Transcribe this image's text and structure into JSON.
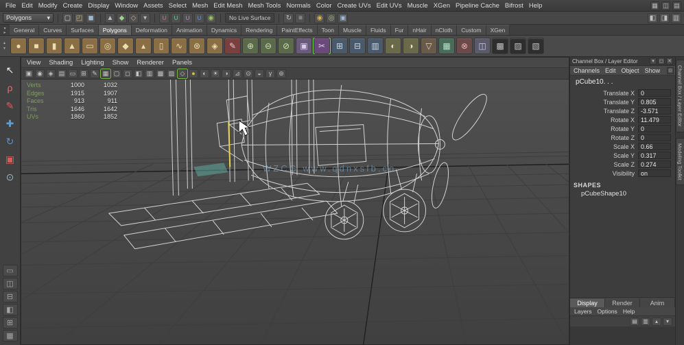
{
  "viewport": {
    "watermark": "WZCG  www.qdnxsfb.co"
  },
  "menubar": {
    "items": [
      "File",
      "Edit",
      "Modify",
      "Create",
      "Display",
      "Window",
      "Assets",
      "Select",
      "Mesh",
      "Edit Mesh",
      "Mesh Tools",
      "Normals",
      "Color",
      "Create UVs",
      "Edit UVs",
      "Muscle",
      "XGen",
      "Pipeline Cache",
      "Bifrost",
      "Help"
    ],
    "corner_icons": [
      {
        "name": "workspace-icon",
        "glyph": "▦"
      },
      {
        "name": "panel-layout-icon",
        "glyph": "◫"
      },
      {
        "name": "outliner-toggle-icon",
        "glyph": "▤"
      }
    ]
  },
  "statusline": {
    "menuset_value": "Polygons",
    "menuset_arrow": "▾",
    "scene_icons": [
      {
        "name": "new-scene-icon",
        "glyph": "▢",
        "color": "#d0d0d0"
      },
      {
        "name": "open-scene-icon",
        "glyph": "◰",
        "color": "#d8c27a"
      },
      {
        "name": "save-scene-icon",
        "glyph": "◼",
        "color": "#9fb7d0"
      }
    ],
    "selection_icons": [
      {
        "name": "select-hierarchy-icon",
        "glyph": "▲",
        "color": "#bcbcbc"
      },
      {
        "name": "select-object-icon",
        "glyph": "◆",
        "color": "#9fd08f"
      },
      {
        "name": "select-component-icon",
        "glyph": "◇",
        "color": "#d0a98f"
      },
      {
        "name": "selection-mask-icon",
        "glyph": "▾",
        "color": "#bbbbbb"
      }
    ],
    "snap_icons": [
      {
        "name": "snap-to-grid-icon",
        "glyph": "∪",
        "color": "#d07070"
      },
      {
        "name": "snap-to-curve-icon",
        "glyph": "∪",
        "color": "#70c090"
      },
      {
        "name": "snap-to-point-icon",
        "glyph": "∪",
        "color": "#c080c0"
      },
      {
        "name": "snap-to-plane-icon",
        "glyph": "∪",
        "color": "#7090c8"
      },
      {
        "name": "make-live-icon",
        "glyph": "◉",
        "color": "#9ac060"
      }
    ],
    "live_surface_label": "No Live Surface",
    "history_icons": [
      {
        "name": "construction-history-icon",
        "glyph": "↻",
        "color": "#bfbfbf"
      },
      {
        "name": "list-inputs-icon",
        "glyph": "≡",
        "color": "#bfbfbf"
      }
    ],
    "render_icons": [
      {
        "name": "render-current-frame-icon",
        "glyph": "◉",
        "color": "#d8b24a"
      },
      {
        "name": "ipr-render-icon",
        "glyph": "◎",
        "color": "#a8c27a"
      },
      {
        "name": "render-settings-icon",
        "glyph": "▣",
        "color": "#9fb7d0"
      }
    ],
    "editor_toggles": [
      {
        "name": "sidebar-toggle-icon",
        "glyph": "◧",
        "color": "#c0c0c0"
      },
      {
        "name": "attribute-editor-toggle-icon",
        "glyph": "◨",
        "color": "#c0c0c0"
      },
      {
        "name": "channel-box-toggle-icon",
        "glyph": "▥",
        "color": "#c0c0c0"
      }
    ]
  },
  "shelf": {
    "tabs": [
      {
        "label": "General"
      },
      {
        "label": "Curves"
      },
      {
        "label": "Surfaces"
      },
      {
        "label": "Polygons",
        "active": true
      },
      {
        "label": "Deformation"
      },
      {
        "label": "Animation"
      },
      {
        "label": "Dynamics"
      },
      {
        "label": "Rendering"
      },
      {
        "label": "PaintEffects"
      },
      {
        "label": "Toon"
      },
      {
        "label": "Muscle"
      },
      {
        "label": "Fluids"
      },
      {
        "label": "Fur"
      },
      {
        "label": "nHair"
      },
      {
        "label": "nCloth"
      },
      {
        "label": "Custom"
      },
      {
        "label": "XGen"
      }
    ],
    "icons": [
      {
        "name": "poly-sphere-icon",
        "glyph": "●",
        "bg": "#8a6f46",
        "color": "#ecdcb4"
      },
      {
        "name": "poly-cube-icon",
        "glyph": "■",
        "bg": "#8a6f46",
        "color": "#ecdcb4"
      },
      {
        "name": "poly-cylinder-icon",
        "glyph": "▮",
        "bg": "#8a6f46",
        "color": "#ecdcb4"
      },
      {
        "name": "poly-cone-icon",
        "glyph": "▲",
        "bg": "#8a6f46",
        "color": "#ecdcb4"
      },
      {
        "name": "poly-plane-icon",
        "glyph": "▭",
        "bg": "#8a6f46",
        "color": "#ecdcb4"
      },
      {
        "name": "poly-torus-icon",
        "glyph": "◎",
        "bg": "#8a6f46",
        "color": "#ecdcb4"
      },
      {
        "name": "poly-prism-icon",
        "glyph": "◆",
        "bg": "#8a6f46",
        "color": "#ecdcb4"
      },
      {
        "name": "poly-pyramid-icon",
        "glyph": "▴",
        "bg": "#8a6f46",
        "color": "#ecdcb4"
      },
      {
        "name": "poly-pipe-icon",
        "glyph": "▯",
        "bg": "#8a6f46",
        "color": "#ecdcb4"
      },
      {
        "name": "poly-helix-icon",
        "glyph": "∿",
        "bg": "#8a6f46",
        "color": "#ecdcb4"
      },
      {
        "name": "poly-soccer-ball-icon",
        "glyph": "⊛",
        "bg": "#8a6f46",
        "color": "#ecdcb4"
      },
      {
        "name": "poly-platonic-icon",
        "glyph": "◈",
        "bg": "#8a6f46",
        "color": "#ecdcb4"
      },
      {
        "name": "sculpt-brush-icon",
        "glyph": "✎",
        "bg": "#7a4040",
        "color": "#f0c4c4"
      },
      {
        "name": "combine-icon",
        "glyph": "⊕",
        "bg": "#5a6a4a",
        "color": "#d2e2b2"
      },
      {
        "name": "separate-icon",
        "glyph": "⊖",
        "bg": "#5a6a4a",
        "color": "#d2e2b2"
      },
      {
        "name": "extract-icon",
        "glyph": "⊘",
        "bg": "#5a6a4a",
        "color": "#d2e2b2"
      },
      {
        "name": "smooth-mesh-icon",
        "glyph": "▣",
        "bg": "#6a5a7a",
        "color": "#dccaf2"
      },
      {
        "name": "multi-cut-icon",
        "glyph": "✂",
        "bg": "#6a4a7a",
        "color": "#e4ccf2",
        "selected": true
      },
      {
        "name": "extrude-icon",
        "glyph": "⊞",
        "bg": "#4a5a6a",
        "color": "#c4d8ec"
      },
      {
        "name": "bevel-icon",
        "glyph": "⊟",
        "bg": "#4a5a6a",
        "color": "#c4d8ec"
      },
      {
        "name": "bridge-icon",
        "glyph": "▥",
        "bg": "#4a5a6a",
        "color": "#c4d8ec"
      },
      {
        "name": "boolean-union-icon",
        "glyph": "◐",
        "bg": "#6a6a4a",
        "color": "#e4e4b4"
      },
      {
        "name": "boolean-difference-icon",
        "glyph": "◑",
        "bg": "#6a6a4a",
        "color": "#e4e4b4"
      },
      {
        "name": "reduce-icon",
        "glyph": "▽",
        "bg": "#6a5a4a",
        "color": "#e4d4c4"
      },
      {
        "name": "quad-draw-icon",
        "glyph": "▦",
        "bg": "#4a6a5a",
        "color": "#b4e4cc"
      },
      {
        "name": "target-weld-icon",
        "glyph": "⊗",
        "bg": "#6a4a4a",
        "color": "#ecb4b4"
      },
      {
        "name": "mirror-icon",
        "glyph": "◫",
        "bg": "#5a5a6a",
        "color": "#ccccec"
      },
      {
        "name": "checker-map-icon",
        "glyph": "▩",
        "bg": "#2e2e2e",
        "color": "#c0c0c0"
      },
      {
        "name": "checker-map-2-icon",
        "glyph": "▨",
        "bg": "#2e2e2e",
        "color": "#c0c0c0"
      },
      {
        "name": "uv-checker-icon",
        "glyph": "▧",
        "bg": "#2e2e2e",
        "color": "#c0c0c0"
      }
    ]
  },
  "toolbox": {
    "tools": [
      {
        "name": "select-tool-icon",
        "glyph": "↖",
        "color": "#ececec"
      },
      {
        "name": "lasso-select-tool-icon",
        "glyph": "ρ",
        "color": "#e07070"
      },
      {
        "name": "paint-select-tool-icon",
        "glyph": "✎",
        "color": "#d86060"
      },
      {
        "name": "move-tool-icon",
        "glyph": "✚",
        "color": "#5aa0d8"
      },
      {
        "name": "rotate-tool-icon",
        "glyph": "↻",
        "color": "#5a90d8"
      },
      {
        "name": "scale-tool-icon",
        "glyph": "▣",
        "color": "#d85a5a"
      },
      {
        "name": "last-tool-icon",
        "glyph": "⊙",
        "color": "#a0b4c0"
      }
    ],
    "layouts": [
      {
        "name": "layout-single-pane-icon",
        "glyph": "▭"
      },
      {
        "name": "layout-two-side-icon",
        "glyph": "◫"
      },
      {
        "name": "layout-two-stacked-icon",
        "glyph": "⊟"
      },
      {
        "name": "layout-three-pane-icon",
        "glyph": "◧"
      },
      {
        "name": "layout-four-pane-icon",
        "glyph": "⊞"
      },
      {
        "name": "layout-outliner-persp-icon",
        "glyph": "▦"
      }
    ]
  },
  "panel": {
    "menus": [
      "View",
      "Shading",
      "Lighting",
      "Show",
      "Renderer",
      "Panels"
    ],
    "toolbar_icons": [
      {
        "name": "view-cube-icon",
        "glyph": "▣"
      },
      {
        "name": "camera-select-icon",
        "glyph": "◉"
      },
      {
        "name": "camera-lock-icon",
        "glyph": "◈"
      },
      {
        "name": "bookmark-icon",
        "glyph": "▤"
      },
      {
        "name": "image-plane-icon",
        "glyph": "▭"
      },
      {
        "name": "2d-pan-zoom-icon",
        "glyph": "⊞"
      },
      {
        "name": "grease-pencil-icon",
        "glyph": "✎"
      },
      {
        "name": "grid-toggle-icon",
        "glyph": "▦",
        "active": true
      },
      {
        "name": "film-gate-icon",
        "glyph": "▢"
      },
      {
        "name": "resolution-gate-icon",
        "glyph": "◻"
      },
      {
        "name": "gate-mask-icon",
        "glyph": "◧"
      },
      {
        "name": "field-chart-icon",
        "glyph": "▥"
      },
      {
        "name": "safe-action-icon",
        "glyph": "▩"
      },
      {
        "name": "safe-title-icon",
        "glyph": "▨"
      },
      {
        "name": "wireframe-mode-icon",
        "glyph": "◇",
        "active": true
      },
      {
        "name": "shaded-mode-icon",
        "glyph": "●",
        "color": "#d8c24a"
      },
      {
        "name": "textured-mode-icon",
        "glyph": "◐"
      },
      {
        "name": "lights-icon",
        "glyph": "☀"
      },
      {
        "name": "shadows-icon",
        "glyph": "◑"
      },
      {
        "name": "xray-icon",
        "glyph": "⊿"
      },
      {
        "name": "isolate-select-icon",
        "glyph": "⊙"
      },
      {
        "name": "exposure-icon",
        "glyph": "◒"
      },
      {
        "name": "gamma-icon",
        "glyph": "γ"
      },
      {
        "name": "ambient-occlusion-icon",
        "glyph": "⊚"
      }
    ]
  },
  "hud": {
    "rows": [
      {
        "label": "Verts",
        "a": "1000",
        "b": "1032"
      },
      {
        "label": "Edges",
        "a": "1915",
        "b": "1907"
      },
      {
        "label": "Faces",
        "a": "913",
        "b": "911"
      },
      {
        "label": "Tris",
        "a": "1646",
        "b": "1642"
      },
      {
        "label": "UVs",
        "a": "1860",
        "b": "1852"
      }
    ]
  },
  "channel_box": {
    "title": "Channel Box / Layer Editor",
    "title_icons": [
      {
        "name": "collapse-panel-icon",
        "glyph": "▾"
      },
      {
        "name": "float-panel-icon",
        "glyph": "◻"
      },
      {
        "name": "close-panel-icon",
        "glyph": "✕"
      }
    ],
    "menus": [
      "Channels",
      "Edit",
      "Object",
      "Show"
    ],
    "menu_icons": [
      {
        "name": "pin-channelbox-icon",
        "glyph": "⊙"
      },
      {
        "name": "channel-sliders-icon",
        "glyph": "≡"
      }
    ],
    "object_name": "pCube10. . .",
    "attributes": [
      {
        "label": "Translate X",
        "value": "0"
      },
      {
        "label": "Translate Y",
        "value": "0.805"
      },
      {
        "label": "Translate Z",
        "value": "-3.571"
      },
      {
        "label": "Rotate X",
        "value": "11.479"
      },
      {
        "label": "Rotate Y",
        "value": "0"
      },
      {
        "label": "Rotate Z",
        "value": "0"
      },
      {
        "label": "Scale X",
        "value": "0.66"
      },
      {
        "label": "Scale Y",
        "value": "0.317"
      },
      {
        "label": "Scale Z",
        "value": "0.274"
      },
      {
        "label": "Visibility",
        "value": "on"
      }
    ],
    "shapes_header": "SHAPES",
    "shape_name": "pCubeShape10"
  },
  "layer_editor": {
    "tabs": [
      {
        "label": "Display",
        "active": true
      },
      {
        "label": "Render"
      },
      {
        "label": "Anim"
      }
    ],
    "menus": [
      "Layers",
      "Options",
      "Help"
    ],
    "toolbar_icons": [
      {
        "name": "new-empty-layer-icon",
        "glyph": "▤"
      },
      {
        "name": "new-layer-assign-icon",
        "glyph": "▥"
      },
      {
        "name": "move-layer-up-icon",
        "glyph": "▴"
      },
      {
        "name": "move-layer-down-icon",
        "glyph": "▾"
      }
    ]
  },
  "right_strip": {
    "tabs": [
      {
        "name": "tab-channel-box-layer-editor",
        "label": "Channel Box / Layer Editor"
      },
      {
        "name": "tab-modeling-toolkit",
        "label": "Modeling Toolkit"
      }
    ]
  }
}
